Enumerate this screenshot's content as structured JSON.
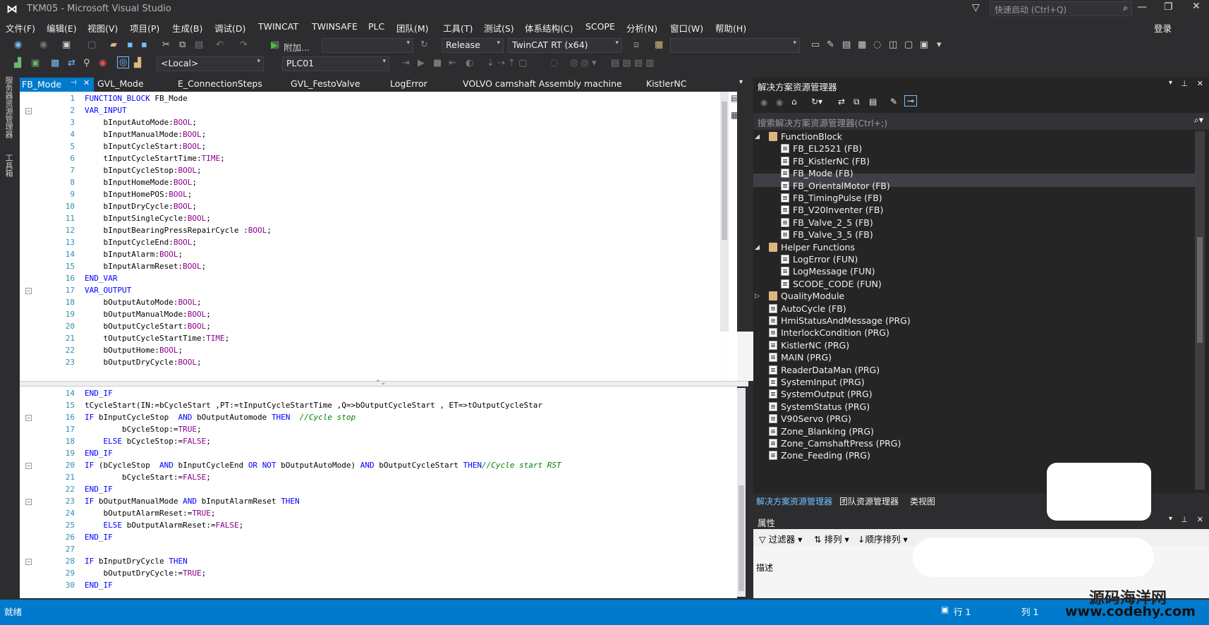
{
  "app": {
    "title": "TKM05 - Microsoft Visual Studio",
    "quick_launch_placeholder": "快速启动 (Ctrl+Q)",
    "login": "登录"
  },
  "menu": [
    "文件(F)",
    "编辑(E)",
    "视图(V)",
    "项目(P)",
    "生成(B)",
    "调试(D)",
    "TWINCAT",
    "TWINSAFE",
    "PLC",
    "团队(M)",
    "工具(T)",
    "测试(S)",
    "体系结构(C)",
    "SCOPE",
    "分析(N)",
    "窗口(W)",
    "帮助(H)"
  ],
  "toolbar": {
    "attach_label": "附加...",
    "config": "Release",
    "platform": "TwinCAT RT (x64)",
    "target": "<Local>",
    "plc": "PLC01"
  },
  "left_strip": {
    "server_explorer": "服务器资源管理器",
    "toolbox": "工具箱"
  },
  "tabs": [
    "FB_Mode",
    "GVL_Mode",
    "E_ConnectionSteps",
    "GVL_FestoValve",
    "LogError",
    "VOLVO camshaft Assembly machine",
    "KistlerNC"
  ],
  "editor_top": {
    "lines": [
      {
        "n": "1",
        "code": "FUNCTION_BLOCK FB_Mode",
        "kw": true
      },
      {
        "n": "2",
        "code": "VAR_INPUT",
        "kw": true,
        "fold": true
      },
      {
        "n": "3",
        "code": "    bInputAutoMode:BOOL;"
      },
      {
        "n": "4",
        "code": "    bInputManualMode:BOOL;"
      },
      {
        "n": "5",
        "code": "    bInputCycleStart:BOOL;"
      },
      {
        "n": "6",
        "code": "    tInputCycleStartTime:TIME;"
      },
      {
        "n": "7",
        "code": "    bInputCycleStop:BOOL;"
      },
      {
        "n": "8",
        "code": "    bInputHomeMode:BOOL;"
      },
      {
        "n": "9",
        "code": "    bInputHomePOS:BOOL;"
      },
      {
        "n": "10",
        "code": "    bInputDryCycle:BOOL;"
      },
      {
        "n": "11",
        "code": "    bInputSingleCycle:BOOL;"
      },
      {
        "n": "12",
        "code": "    bInputBearingPressRepairCycle :BOOL;"
      },
      {
        "n": "13",
        "code": "    bInputCycleEnd:BOOL;"
      },
      {
        "n": "14",
        "code": "    bInputAlarm:BOOL;"
      },
      {
        "n": "15",
        "code": "    bInputAlarmReset:BOOL;"
      },
      {
        "n": "16",
        "code": "END_VAR",
        "kw": true
      },
      {
        "n": "17",
        "code": "VAR_OUTPUT",
        "kw": true,
        "fold": true
      },
      {
        "n": "18",
        "code": "    bOutputAutoMode:BOOL;"
      },
      {
        "n": "19",
        "code": "    bOutputManualMode:BOOL;"
      },
      {
        "n": "20",
        "code": "    bOutputCycleStart:BOOL;"
      },
      {
        "n": "21",
        "code": "    tOutputCycleStartTime:TIME;"
      },
      {
        "n": "22",
        "code": "    bOutputHome:BOOL;"
      },
      {
        "n": "23",
        "code": "    bOutputDryCycle:BOOL;"
      }
    ]
  },
  "editor_bottom": {
    "lines": [
      {
        "n": "14",
        "code": "END_IF",
        "kw": true
      },
      {
        "n": "15",
        "code": "tCycleStart(IN:=bCycleStart ,PT:=tInputCycleStartTime ,Q=>bOutputCycleStart , ET=>tOutputCycleStar"
      },
      {
        "n": "16",
        "code": "IF bInputCycleStop  AND bOutputAutomode THEN  ",
        "comment": "//Cycle stop",
        "fold": true
      },
      {
        "n": "17",
        "code": "        bCycleStop:=TRUE;"
      },
      {
        "n": "18",
        "code": "    ELSE bCycleStop:=FALSE;"
      },
      {
        "n": "19",
        "code": "END_IF",
        "kw": true
      },
      {
        "n": "20",
        "code": "IF (bCycleStop  AND bInputCycleEnd OR NOT bOutputAutoMode) AND bOutputCycleStart THEN",
        "comment": "//Cycle start RST",
        "fold": true
      },
      {
        "n": "21",
        "code": "        bCycleStart:=FALSE;"
      },
      {
        "n": "22",
        "code": "END_IF",
        "kw": true
      },
      {
        "n": "23",
        "code": "IF bOutputManualMode AND bInputAlarmReset THEN",
        "fold": true
      },
      {
        "n": "24",
        "code": "    bOutputAlarmReset:=TRUE;"
      },
      {
        "n": "25",
        "code": "    ELSE bOutputAlarmReset:=FALSE;"
      },
      {
        "n": "26",
        "code": "END_IF",
        "kw": true
      },
      {
        "n": "27",
        "code": ""
      },
      {
        "n": "28",
        "code": "IF bInputDryCycle THEN",
        "fold": true
      },
      {
        "n": "29",
        "code": "    bOutputDryCycle:=TRUE;"
      },
      {
        "n": "30",
        "code": "END_IF",
        "kw": true
      }
    ]
  },
  "solution_explorer": {
    "title": "解决方案资源管理器",
    "search_placeholder": "搜索解决方案资源管理器(Ctrl+;)",
    "items": [
      {
        "label": "FunctionBlock",
        "type": "folder",
        "level": 1,
        "expanded": true
      },
      {
        "label": "FB_EL2521 (FB)",
        "type": "file",
        "level": 2
      },
      {
        "label": "FB_KistlerNC (FB)",
        "type": "file",
        "level": 2
      },
      {
        "label": "FB_Mode (FB)",
        "type": "file",
        "level": 2,
        "selected": true
      },
      {
        "label": "FB_OrientalMotor (FB)",
        "type": "file",
        "level": 2
      },
      {
        "label": "FB_TimingPulse (FB)",
        "type": "file",
        "level": 2
      },
      {
        "label": "FB_V20Inventer (FB)",
        "type": "file",
        "level": 2
      },
      {
        "label": "FB_Valve_2_5 (FB)",
        "type": "file",
        "level": 2
      },
      {
        "label": "FB_Valve_3_5 (FB)",
        "type": "file",
        "level": 2
      },
      {
        "label": "Helper Functions",
        "type": "folder",
        "level": 1,
        "expanded": true
      },
      {
        "label": "LogError (FUN)",
        "type": "file",
        "level": 2
      },
      {
        "label": "LogMessage (FUN)",
        "type": "file",
        "level": 2
      },
      {
        "label": "SCODE_CODE (FUN)",
        "type": "file",
        "level": 2
      },
      {
        "label": "QualityModule",
        "type": "folder",
        "level": 1,
        "expanded": false
      },
      {
        "label": "AutoCycle (FB)",
        "type": "file",
        "level": 0
      },
      {
        "label": "HmiStatusAndMessage (PRG)",
        "type": "file",
        "level": 0
      },
      {
        "label": "InterlockCondition (PRG)",
        "type": "file",
        "level": 0
      },
      {
        "label": "KistlerNC (PRG)",
        "type": "file",
        "level": 0
      },
      {
        "label": "MAIN (PRG)",
        "type": "file",
        "level": 0
      },
      {
        "label": "ReaderDataMan (PRG)",
        "type": "file",
        "level": 0
      },
      {
        "label": "SystemInput (PRG)",
        "type": "file",
        "level": 0
      },
      {
        "label": "SystemOutput (PRG)",
        "type": "file",
        "level": 0
      },
      {
        "label": "SystemStatus (PRG)",
        "type": "file",
        "level": 0
      },
      {
        "label": "V90Servo (PRG)",
        "type": "file",
        "level": 0
      },
      {
        "label": "Zone_Blanking (PRG)",
        "type": "file",
        "level": 0
      },
      {
        "label": "Zone_CamshaftPress (PRG)",
        "type": "file",
        "level": 0
      },
      {
        "label": "Zone_Feeding (PRG)",
        "type": "file",
        "level": 0
      }
    ]
  },
  "panel_tabs": [
    "解决方案资源管理器",
    "团队资源管理器",
    "类视图"
  ],
  "properties": {
    "title": "属性",
    "filter": "过滤器",
    "sort": "排列",
    "order": "顺序排列",
    "description": "描述"
  },
  "status": {
    "ready": "就绪",
    "line": "行 1",
    "col": "列 1"
  },
  "watermark": {
    "line1": "源码海洋网",
    "line2": "www.codehy.com"
  }
}
